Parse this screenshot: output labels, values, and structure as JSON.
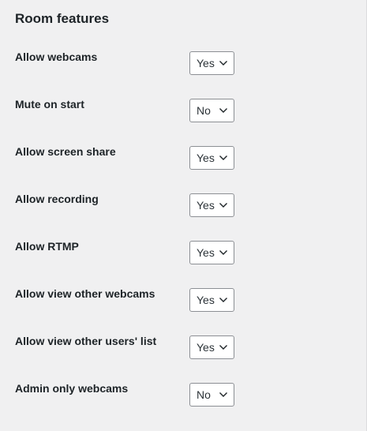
{
  "section": {
    "title": "Room features"
  },
  "features": [
    {
      "label": "Allow webcams",
      "value": "Yes"
    },
    {
      "label": "Mute on start",
      "value": "No"
    },
    {
      "label": "Allow screen share",
      "value": "Yes"
    },
    {
      "label": "Allow recording",
      "value": "Yes"
    },
    {
      "label": "Allow RTMP",
      "value": "Yes"
    },
    {
      "label": "Allow view other webcams",
      "value": "Yes"
    },
    {
      "label": "Allow view other users' list",
      "value": "Yes"
    },
    {
      "label": "Admin only webcams",
      "value": "No"
    }
  ],
  "icons": {
    "select_arrow": "chevron-down-icon"
  },
  "colors": {
    "background": "#f0f0f1",
    "text": "#1d2327",
    "select_border": "#8c8f94",
    "select_background": "#ffffff"
  }
}
